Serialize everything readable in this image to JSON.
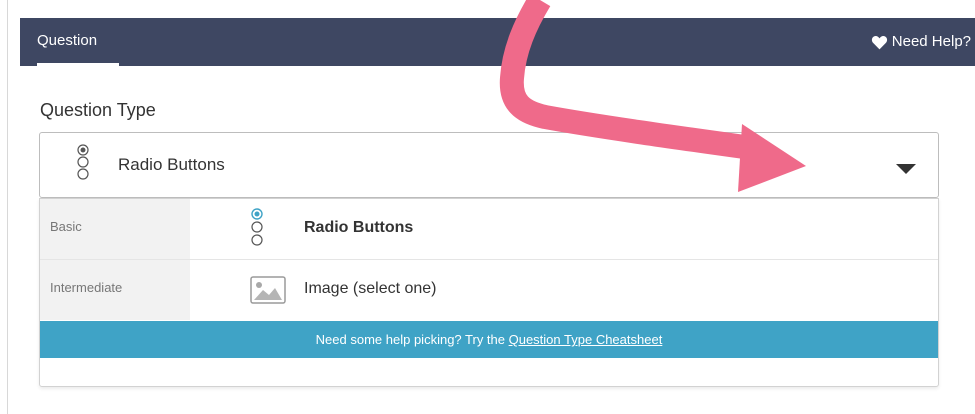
{
  "header": {
    "tab_label": "Question",
    "help_label": "Need Help?"
  },
  "field": {
    "label": "Question Type",
    "selected_value": "Radio Buttons"
  },
  "dropdown": {
    "rows": [
      {
        "category": "Basic",
        "option": "Radio Buttons",
        "icon": "radio-buttons-icon",
        "highlighted": true
      },
      {
        "category": "Intermediate",
        "option": "Image (select one)",
        "icon": "image-icon",
        "highlighted": false
      }
    ],
    "help_text": "Need some help picking? Try the ",
    "help_link": "Question Type Cheatsheet"
  },
  "colors": {
    "header_bg": "#3e4762",
    "banner_bg": "#3fa3c6",
    "radio_selected": "#3fa3c6",
    "annotation_arrow": "#ef6a8a"
  }
}
